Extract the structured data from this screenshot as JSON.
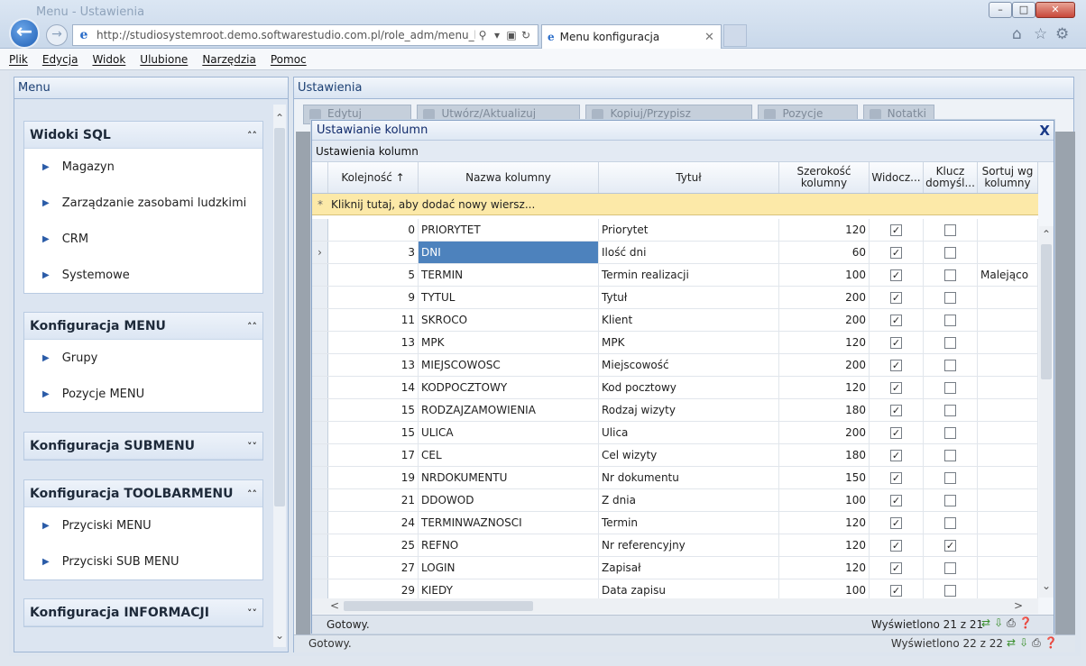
{
  "browser": {
    "ghost_title": "Menu - Ustawienia",
    "url": "http://studiosystemroot.demo.softwarestudio.com.pl/role_adm/menu_konfigur",
    "tab_title": "Menu konfiguracja",
    "window_buttons": {
      "minimize": "–",
      "maximize": "□",
      "close": "✕"
    },
    "menubar": [
      "Plik",
      "Edycja",
      "Widok",
      "Ulubione",
      "Narzędzia",
      "Pomoc"
    ]
  },
  "left_panel": {
    "header": "Menu",
    "groups": [
      {
        "title": "Widoki SQL",
        "items": [
          "Magazyn",
          "Zarządzanie zasobami ludzkimi",
          "CRM",
          "Systemowe"
        ],
        "chevron": "˄˄"
      },
      {
        "title": "Konfiguracja MENU",
        "items": [
          "Grupy",
          "Pozycje MENU"
        ],
        "chevron": "˄˄"
      },
      {
        "title": "Konfiguracja SUBMENU",
        "items": [],
        "chevron": "˅˅"
      },
      {
        "title": "Konfiguracja TOOLBARMENU",
        "items": [
          "Przyciski MENU",
          "Przyciski SUB MENU"
        ],
        "chevron": "˄˄"
      },
      {
        "title": "Konfiguracja INFORMACJI",
        "items": [],
        "chevron": "˅˅"
      }
    ]
  },
  "right_panel": {
    "header": "Ustawienia",
    "toolbar": [
      "Edytuj kolumny",
      "Utwórz/Aktualizuj kolumny",
      "Kopiuj/Przypisz zestawienie",
      "Pozycje Menu",
      "Notatki"
    ],
    "status": "Gotowy.",
    "count": "Wyświetlono 22 z 22"
  },
  "dialog": {
    "title": "Ustawianie kolumn",
    "close": "X",
    "caption": "Ustawienia kolumn",
    "columns": [
      "Kolejność ↑",
      "Nazwa kolumny",
      "Tytuł",
      "Szerokość\nkolumny",
      "Widocz...",
      "Klucz\ndomyśl...",
      "Sortuj wg\nkolumny"
    ],
    "new_row_text": "Kliknij tutaj, aby dodać nowy wiersz...",
    "rows": [
      {
        "order": "0",
        "name": "PRIORYTET",
        "title": "Priorytet",
        "width": "120",
        "visible": true,
        "key": false,
        "sort": ""
      },
      {
        "order": "3",
        "name": "DNI",
        "title": "Ilość dni",
        "width": "60",
        "visible": true,
        "key": false,
        "sort": "",
        "selected": true
      },
      {
        "order": "5",
        "name": "TERMIN",
        "title": "Termin realizacji",
        "width": "100",
        "visible": true,
        "key": false,
        "sort": "Malejąco"
      },
      {
        "order": "9",
        "name": "TYTUL",
        "title": "Tytuł",
        "width": "200",
        "visible": true,
        "key": false,
        "sort": ""
      },
      {
        "order": "11",
        "name": "SKROCO",
        "title": "Klient",
        "width": "200",
        "visible": true,
        "key": false,
        "sort": ""
      },
      {
        "order": "13",
        "name": "MPK",
        "title": "MPK",
        "width": "120",
        "visible": true,
        "key": false,
        "sort": ""
      },
      {
        "order": "13",
        "name": "MIEJSCOWOSC",
        "title": "Miejscowość",
        "width": "200",
        "visible": true,
        "key": false,
        "sort": ""
      },
      {
        "order": "14",
        "name": "KODPOCZTOWY",
        "title": "Kod pocztowy",
        "width": "120",
        "visible": true,
        "key": false,
        "sort": ""
      },
      {
        "order": "15",
        "name": "RODZAJZAMOWIENIA",
        "title": "Rodzaj wizyty",
        "width": "180",
        "visible": true,
        "key": false,
        "sort": ""
      },
      {
        "order": "15",
        "name": "ULICA",
        "title": "Ulica",
        "width": "200",
        "visible": true,
        "key": false,
        "sort": ""
      },
      {
        "order": "17",
        "name": "CEL",
        "title": "Cel wizyty",
        "width": "180",
        "visible": true,
        "key": false,
        "sort": ""
      },
      {
        "order": "19",
        "name": "NRDOKUMENTU",
        "title": "Nr dokumentu",
        "width": "150",
        "visible": true,
        "key": false,
        "sort": ""
      },
      {
        "order": "21",
        "name": "DDOWOD",
        "title": "Z dnia",
        "width": "100",
        "visible": true,
        "key": false,
        "sort": ""
      },
      {
        "order": "24",
        "name": "TERMINWAZNOSCI",
        "title": "Termin",
        "width": "120",
        "visible": true,
        "key": false,
        "sort": ""
      },
      {
        "order": "25",
        "name": "REFNO",
        "title": "Nr referencyjny",
        "width": "120",
        "visible": true,
        "key": true,
        "sort": ""
      },
      {
        "order": "27",
        "name": "LOGIN",
        "title": "Zapisał",
        "width": "120",
        "visible": true,
        "key": false,
        "sort": ""
      },
      {
        "order": "29",
        "name": "KIEDY",
        "title": "Data zapisu",
        "width": "100",
        "visible": true,
        "key": false,
        "sort": ""
      }
    ],
    "status": "Gotowy.",
    "count": "Wyświetlono 21 z 21"
  }
}
